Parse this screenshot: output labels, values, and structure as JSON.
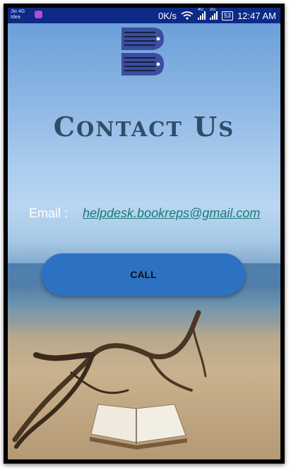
{
  "status_bar": {
    "carrier_1": "Jio 4G",
    "carrier_2": "Idea",
    "net_speed": "0K/s",
    "signal_1_tag": "4G",
    "signal_2_tag": "2G",
    "battery": "53",
    "time": "12:47 AM"
  },
  "page": {
    "title_first_cap": "C",
    "title_rest_1": "ONTACT",
    "title_second_cap": "U",
    "title_rest_2": "S",
    "email_label": "Email :",
    "email": "helpdesk.bookreps@gmail.com",
    "call_button": "CALL"
  },
  "colors": {
    "status_bar": "#0d2a86",
    "title": "#2f4d66",
    "email_link": "#1c7a7a",
    "call_button": "#2d72c2"
  }
}
